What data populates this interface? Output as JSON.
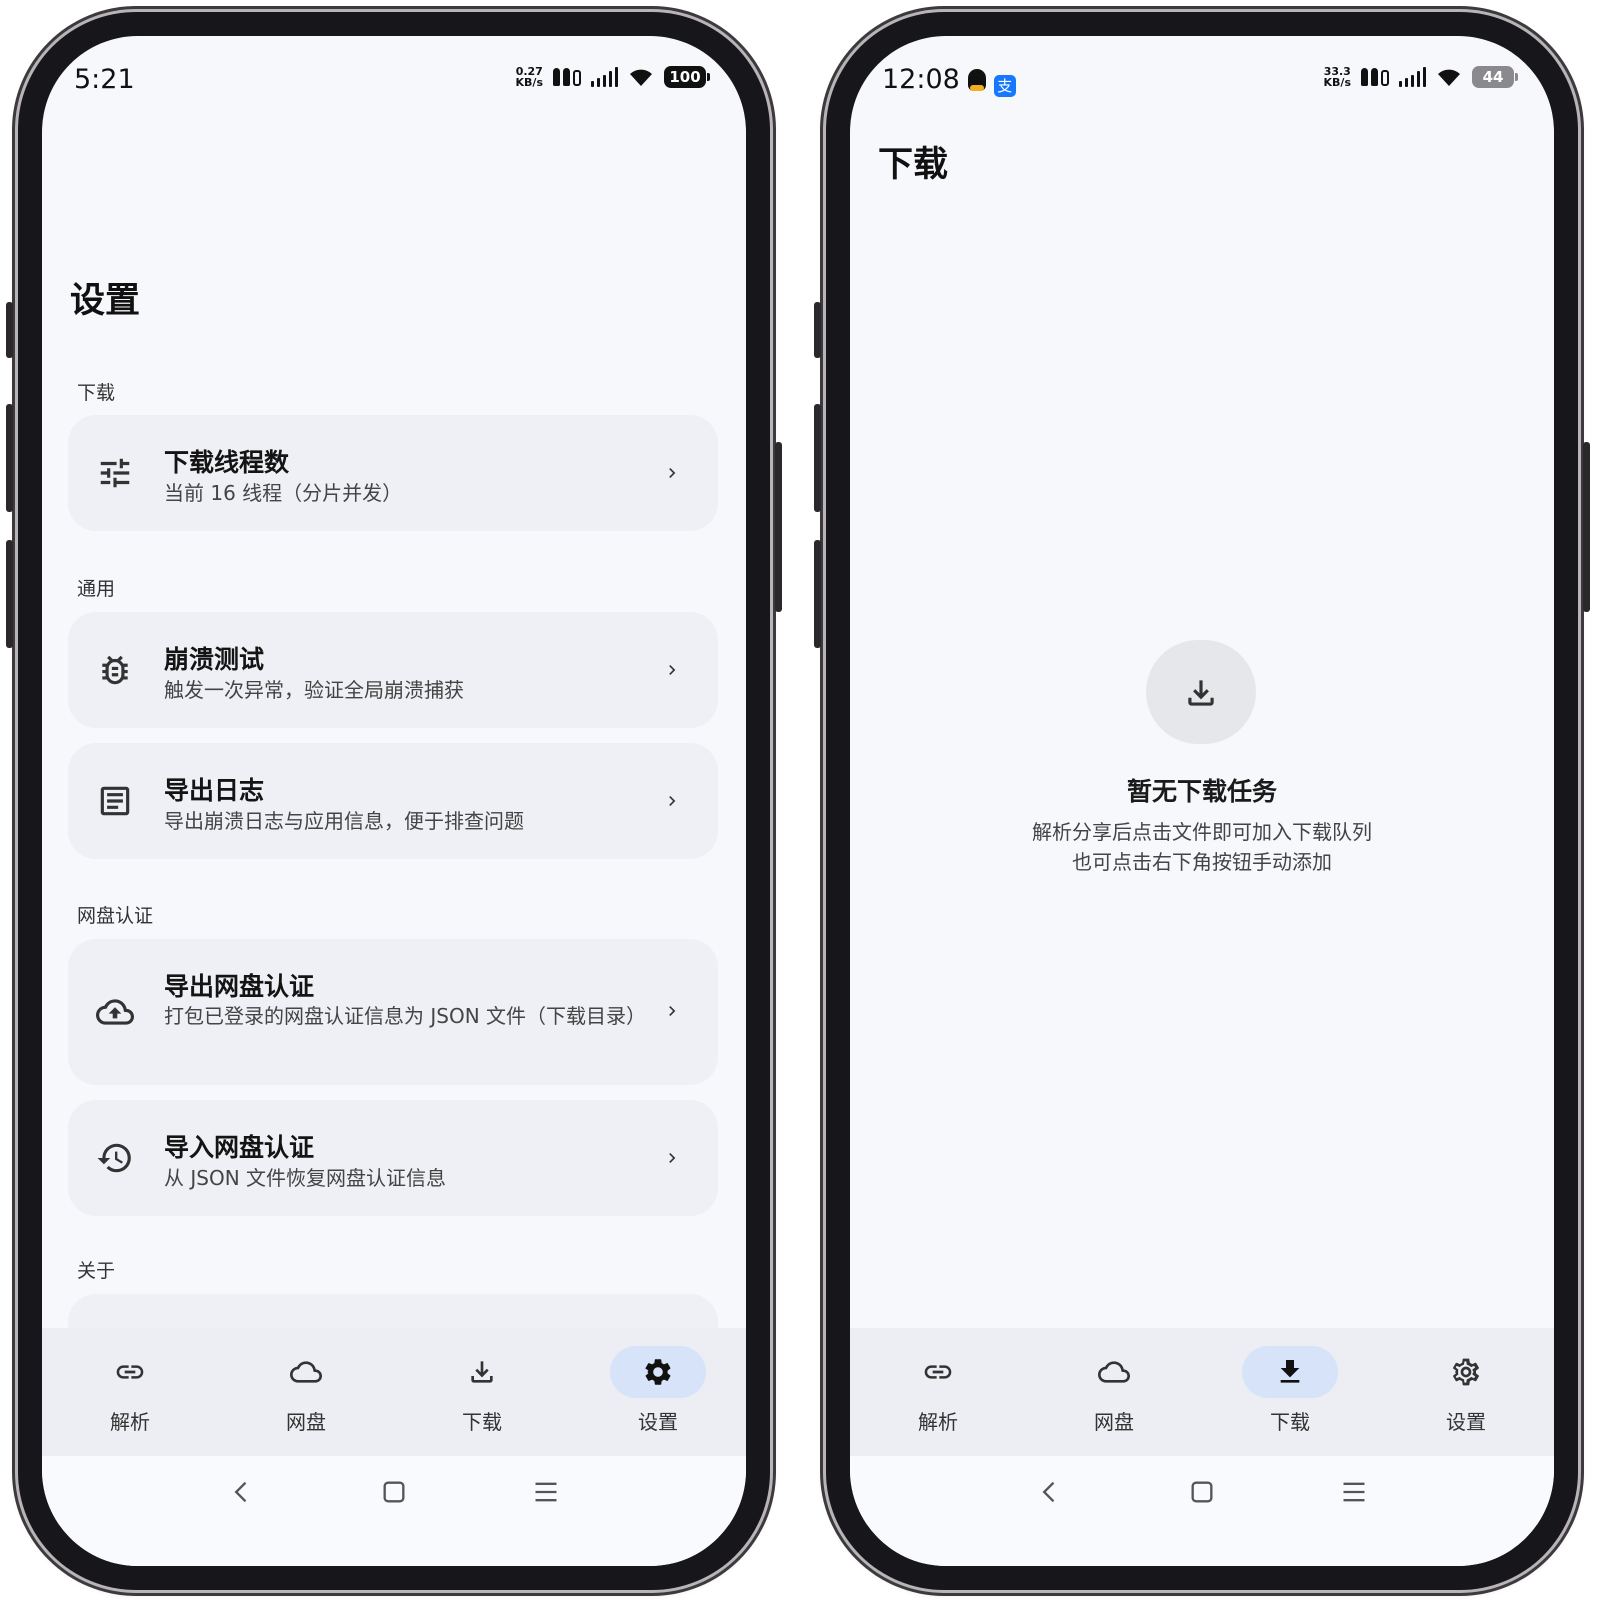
{
  "left": {
    "status": {
      "time": "5:21",
      "speed_value": "0.27",
      "speed_unit": "KB/s",
      "battery": "100"
    },
    "title": "设置",
    "sections": {
      "download": "下载",
      "general": "通用",
      "auth": "网盘认证",
      "about": "关于"
    },
    "items": {
      "threads": {
        "title": "下载线程数",
        "subtitle": "当前 16 线程（分片并发）",
        "icon": "tune-icon"
      },
      "crash": {
        "title": "崩溃测试",
        "subtitle": "触发一次异常，验证全局崩溃捕获",
        "icon": "bug-icon"
      },
      "logs": {
        "title": "导出日志",
        "subtitle": "导出崩溃日志与应用信息，便于排查问题",
        "icon": "article-icon"
      },
      "export_auth": {
        "title": "导出网盘认证",
        "subtitle": "打包已登录的网盘认证信息为 JSON 文件（下载目录）",
        "icon": "cloud-upload-icon"
      },
      "import_auth": {
        "title": "导入网盘认证",
        "subtitle": "从 JSON 文件恢复网盘认证信息",
        "icon": "history-icon"
      }
    },
    "active_tab": "settings"
  },
  "right": {
    "status": {
      "time": "12:08",
      "speed_value": "33.3",
      "speed_unit": "KB/s",
      "battery": "44",
      "alipay_glyph": "支"
    },
    "title": "下载",
    "empty": {
      "title": "暂无下载任务",
      "line1": "解析分享后点击文件即可加入下载队列",
      "line2": "也可点击右下角按钮手动添加"
    },
    "active_tab": "download"
  },
  "tabs": {
    "parse": "解析",
    "cloud": "网盘",
    "download": "下载",
    "settings": "设置"
  },
  "colors": {
    "accent_pill": "#d6e3f8",
    "background": "#f7f8fc",
    "card": "#eef0f5"
  }
}
